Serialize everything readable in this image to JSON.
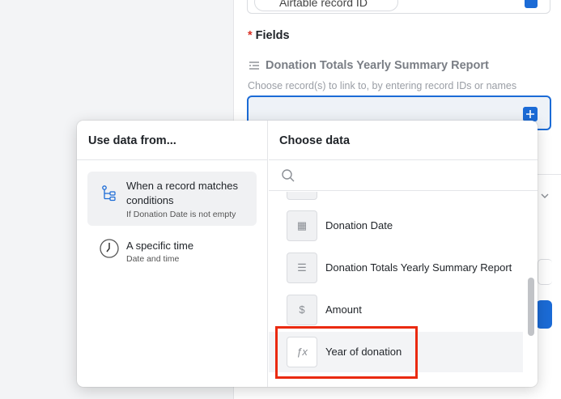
{
  "record_id_field": {
    "label": "Airtable record ID"
  },
  "fields_section": {
    "required_mark": "*",
    "label": "Fields"
  },
  "linked_field": {
    "name": "Donation Totals Yearly Summary Report",
    "hint": "Choose record(s) to link to, by entering record IDs or names"
  },
  "popover": {
    "left_header": "Use data from...",
    "right_header": "Choose data",
    "sources": [
      {
        "title": "When a record matches conditions",
        "subtitle": "If Donation Date is not empty",
        "icon": "tree-conditions-icon",
        "selected": true
      },
      {
        "title": "A specific time",
        "subtitle": "Date and time",
        "icon": "clock-icon",
        "selected": false
      }
    ],
    "search": {
      "placeholder": ""
    },
    "fields": [
      {
        "label": "",
        "icon": "field-icon"
      },
      {
        "label": "Donation Date",
        "icon": "calendar-icon",
        "glyph": "▦"
      },
      {
        "label": "Donation Totals Yearly Summary Report",
        "icon": "linked-record-icon",
        "glyph": "☰"
      },
      {
        "label": "Amount",
        "icon": "currency-icon",
        "glyph": "$"
      },
      {
        "label": "Year of donation",
        "icon": "formula-icon",
        "glyph": "ƒx"
      }
    ]
  },
  "colors": {
    "accent": "#1b6bd6",
    "highlight_border": "#ea2a10",
    "required": "#d93025"
  }
}
